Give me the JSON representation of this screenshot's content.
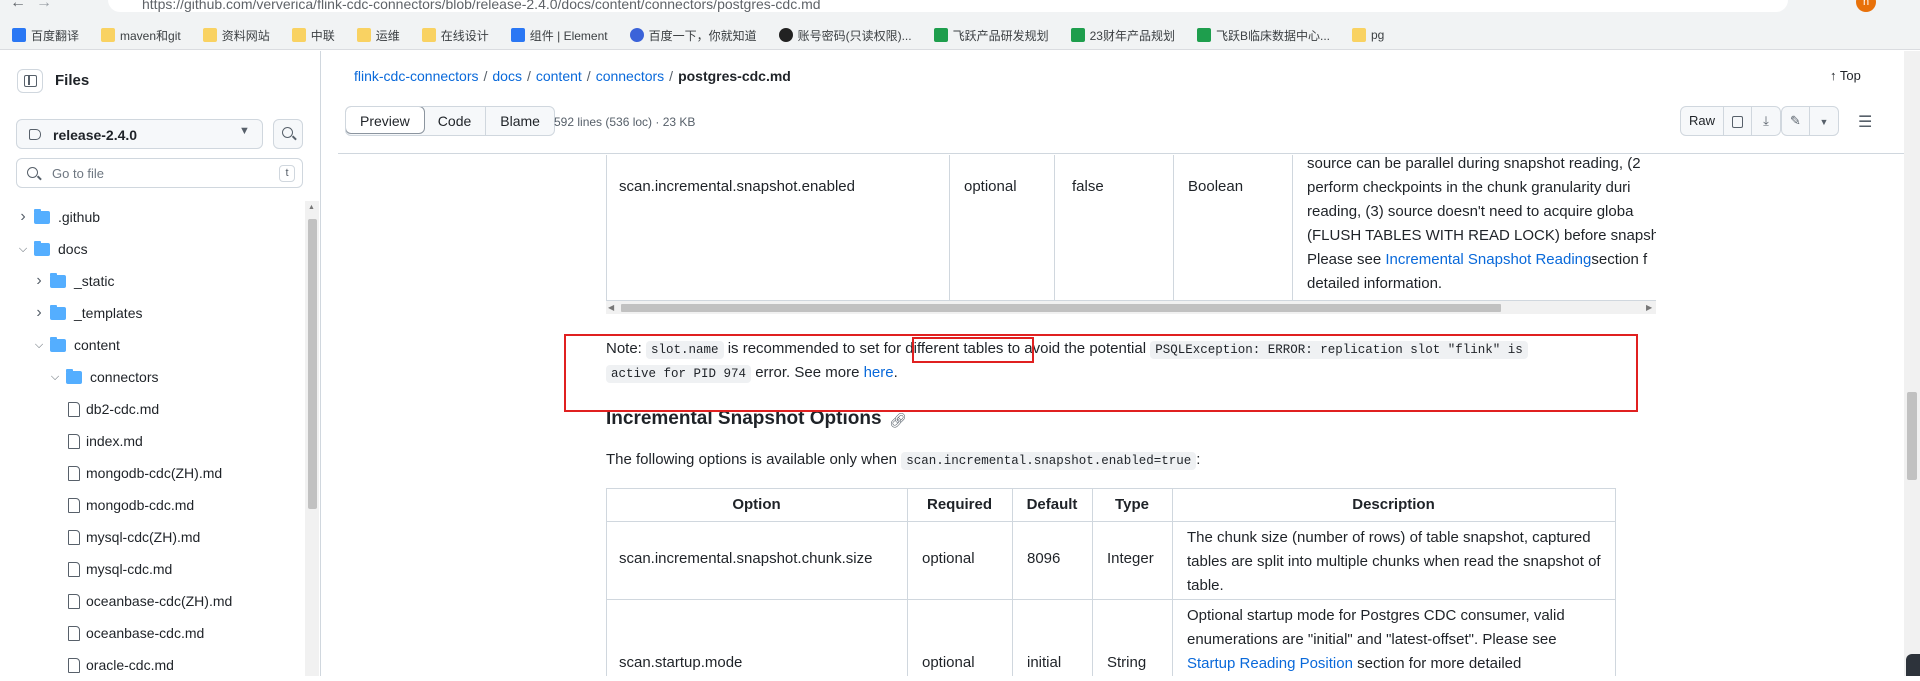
{
  "browser": {
    "url": "https://github.com/ververica/flink-cdc-connectors/blob/release-2.4.0/docs/content/connectors/postgres-cdc.md",
    "profile_initial": "n",
    "bookmarks": [
      {
        "label": "百度翻译",
        "icon": "blue"
      },
      {
        "label": "maven和git",
        "icon": "folder"
      },
      {
        "label": "资料网站",
        "icon": "folder"
      },
      {
        "label": "中联",
        "icon": "folder"
      },
      {
        "label": "运维",
        "icon": "folder"
      },
      {
        "label": "在线设计",
        "icon": "folder"
      },
      {
        "label": "组件 | Element",
        "icon": "blue"
      },
      {
        "label": "百度一下，你就知道",
        "icon": "paw"
      },
      {
        "label": "账号密码(只读权限)...",
        "icon": "dark"
      },
      {
        "label": "飞跃产品研发规划",
        "icon": "green"
      },
      {
        "label": "23财年产品规划",
        "icon": "green"
      },
      {
        "label": "飞跃B临床数据中心...",
        "icon": "green"
      },
      {
        "label": "pg",
        "icon": "folder"
      }
    ]
  },
  "sidebar": {
    "title": "Files",
    "branch": "release-2.4.0",
    "goto_placeholder": "Go to file",
    "goto_shortcut": "t",
    "tree": [
      {
        "label": ".github",
        "type": "folder",
        "depth": 0,
        "expanded": false
      },
      {
        "label": "docs",
        "type": "folder",
        "depth": 0,
        "expanded": true
      },
      {
        "label": "_static",
        "type": "folder",
        "depth": 1,
        "expanded": false
      },
      {
        "label": "_templates",
        "type": "folder",
        "depth": 1,
        "expanded": false
      },
      {
        "label": "content",
        "type": "folder",
        "depth": 1,
        "expanded": true
      },
      {
        "label": "connectors",
        "type": "folder",
        "depth": 2,
        "expanded": true
      },
      {
        "label": "db2-cdc.md",
        "type": "file",
        "depth": 3
      },
      {
        "label": "index.md",
        "type": "file",
        "depth": 3
      },
      {
        "label": "mongodb-cdc(ZH).md",
        "type": "file",
        "depth": 3
      },
      {
        "label": "mongodb-cdc.md",
        "type": "file",
        "depth": 3
      },
      {
        "label": "mysql-cdc(ZH).md",
        "type": "file",
        "depth": 3
      },
      {
        "label": "mysql-cdc.md",
        "type": "file",
        "depth": 3
      },
      {
        "label": "oceanbase-cdc(ZH).md",
        "type": "file",
        "depth": 3
      },
      {
        "label": "oceanbase-cdc.md",
        "type": "file",
        "depth": 3
      },
      {
        "label": "oracle-cdc.md",
        "type": "file",
        "depth": 3
      }
    ]
  },
  "header": {
    "breadcrumb": [
      "flink-cdc-connectors",
      "docs",
      "content",
      "connectors"
    ],
    "current_file": "postgres-cdc.md",
    "top_label": "Top",
    "tabs": [
      "Preview",
      "Code",
      "Blame"
    ],
    "meta": "592 lines (536 loc) · 23 KB",
    "raw_label": "Raw"
  },
  "content": {
    "table1_row": {
      "option": "scan.incremental.snapshot.enabled",
      "required": "optional",
      "default": "false",
      "type": "Boolean",
      "desc_lines": [
        "source can be parallel during snapshot reading, (2",
        "perform checkpoints in the chunk granularity duri",
        "reading, (3) source doesn't need to acquire globa",
        "(FLUSH TABLES WITH READ LOCK) before snapsho"
      ],
      "desc_see_prefix": "Please see ",
      "desc_link": "Incremental Snapshot Reading",
      "desc_see_suffix": "section f",
      "desc_last": "detailed information."
    },
    "note": {
      "prefix": "Note: ",
      "code1": "slot.name",
      "mid1": " is recommended to set for ",
      "highlight": "different tables",
      "mid2": " to avoid the potential ",
      "code2a": "PSQLException: ERROR: replication slot \"flink\" is",
      "code2b": "active for PID 974",
      "mid3": " error. See more ",
      "link": "here",
      "end": "."
    },
    "heading": "Incremental Snapshot Options",
    "intro_prefix": "The following options is available only when ",
    "intro_code": "scan.incremental.snapshot.enabled=true",
    "intro_suffix": ":",
    "table2": {
      "headers": [
        "Option",
        "Required",
        "Default",
        "Type",
        "Description"
      ],
      "rows": [
        {
          "option": "scan.incremental.snapshot.chunk.size",
          "required": "optional",
          "default": "8096",
          "type": "Integer",
          "desc": "The chunk size (number of rows) of table snapshot, captured tables are split into multiple chunks when read the snapshot of table."
        },
        {
          "option": "scan.startup.mode",
          "required": "optional",
          "default": "initial",
          "type": "String",
          "desc_prefix": "Optional startup mode for Postgres CDC consumer, valid enumerations are \"initial\" and \"latest-offset\". Please see ",
          "desc_link": "Startup Reading Position",
          "desc_suffix": " section for more detailed"
        }
      ]
    }
  }
}
